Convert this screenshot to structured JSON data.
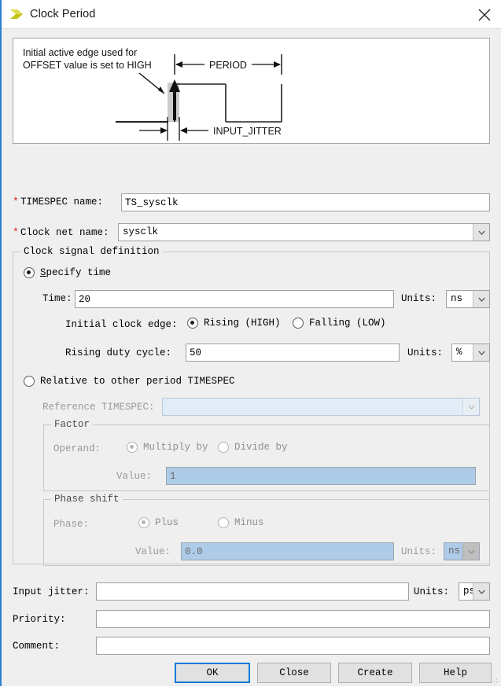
{
  "window": {
    "title": "Clock Period",
    "icon": "yellow-chevron-icon",
    "close_label": "×",
    "accent_blue": "#2f7fd0",
    "bg": "#efefef"
  },
  "diagram": {
    "caption_line1": "Initial active edge used for",
    "caption_line2": "OFFSET value is set to HIGH",
    "period_label": "PERIOD",
    "jitter_label": "INPUT_JITTER"
  },
  "fields": {
    "timespec_name": {
      "required_marker": "*",
      "label": "TIMESPEC name:",
      "value": "TS_sysclk"
    },
    "clock_net_name": {
      "required_marker": "*",
      "label": "Clock net name:",
      "value": "sysclk"
    }
  },
  "clock_signal_definition": {
    "group_title": "Clock signal definition",
    "specify_time": {
      "label": "Specify time",
      "mnemonic": "S",
      "selected": true
    },
    "time": {
      "label": "Time:",
      "value": "20",
      "units_label": "Units:",
      "units_value": "ns"
    },
    "initial_clock_edge": {
      "label": "Initial clock edge:",
      "options": [
        {
          "label": "Rising (HIGH)",
          "selected": true
        },
        {
          "label": "Falling (LOW)",
          "selected": false
        }
      ]
    },
    "rising_duty_cycle": {
      "label": "Rising duty cycle:",
      "value": "50",
      "units_label": "Units:",
      "units_value": "%"
    },
    "relative_to_other": {
      "label": "Relative to other period TIMESPEC",
      "selected": false
    },
    "reference_timespec": {
      "label": "Reference TIMESPEC:",
      "value": "",
      "disabled": true
    },
    "factor": {
      "group_title": "Factor",
      "operand_label": "Operand:",
      "options": [
        {
          "label": "Multiply by",
          "selected": true
        },
        {
          "label": "Divide by",
          "selected": false
        }
      ],
      "value_label": "Value:",
      "value": "1",
      "disabled": true
    },
    "phase_shift": {
      "group_title": "Phase shift",
      "phase_label": "Phase:",
      "options": [
        {
          "label": "Plus",
          "selected": true
        },
        {
          "label": "Minus",
          "selected": false
        }
      ],
      "value_label": "Value:",
      "value": "0.0",
      "units_label": "Units:",
      "units_value": "ns",
      "disabled": true
    }
  },
  "bottom_fields": {
    "input_jitter": {
      "label": "Input jitter:",
      "value": "",
      "units_label": "Units:",
      "units_value": "ps"
    },
    "priority": {
      "label": "Priority:",
      "value": ""
    },
    "comment": {
      "label": "Comment:",
      "value": ""
    }
  },
  "buttons": {
    "ok": "OK",
    "close": "Close",
    "create": "Create",
    "help": "Help"
  }
}
